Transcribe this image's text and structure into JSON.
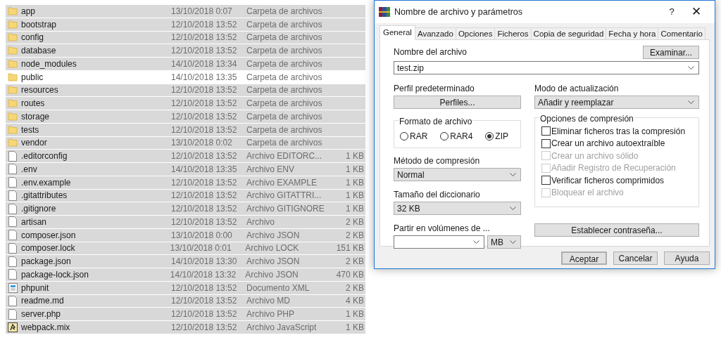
{
  "file_list": {
    "rows": [
      {
        "kind": "folder",
        "name": "app",
        "date": "13/10/2018 0:07",
        "type": "Carpeta de archivos",
        "selected": true
      },
      {
        "kind": "folder",
        "name": "bootstrap",
        "date": "12/10/2018 13:52",
        "type": "Carpeta de archivos",
        "selected": true
      },
      {
        "kind": "folder",
        "name": "config",
        "date": "12/10/2018 13:52",
        "type": "Carpeta de archivos",
        "selected": true
      },
      {
        "kind": "folder",
        "name": "database",
        "date": "12/10/2018 13:52",
        "type": "Carpeta de archivos",
        "selected": true
      },
      {
        "kind": "folder",
        "name": "node_modules",
        "date": "14/10/2018 13:34",
        "type": "Carpeta de archivos",
        "selected": true
      },
      {
        "kind": "folder",
        "name": "public",
        "date": "14/10/2018 13:35",
        "type": "Carpeta de archivos",
        "selected": false
      },
      {
        "kind": "folder",
        "name": "resources",
        "date": "12/10/2018 13:52",
        "type": "Carpeta de archivos",
        "selected": true
      },
      {
        "kind": "folder",
        "name": "routes",
        "date": "12/10/2018 13:52",
        "type": "Carpeta de archivos",
        "selected": true
      },
      {
        "kind": "folder",
        "name": "storage",
        "date": "12/10/2018 13:52",
        "type": "Carpeta de archivos",
        "selected": true
      },
      {
        "kind": "folder",
        "name": "tests",
        "date": "12/10/2018 13:52",
        "type": "Carpeta de archivos",
        "selected": true
      },
      {
        "kind": "folder",
        "name": "vendor",
        "date": "13/10/2018 0:02",
        "type": "Carpeta de archivos",
        "selected": true
      },
      {
        "kind": "file",
        "name": ".editorconfig",
        "date": "12/10/2018 13:52",
        "type": "Archivo EDITORC...",
        "size": "1 KB",
        "selected": true
      },
      {
        "kind": "file",
        "name": ".env",
        "date": "14/10/2018 13:35",
        "type": "Archivo ENV",
        "size": "1 KB",
        "selected": true
      },
      {
        "kind": "file",
        "name": ".env.example",
        "date": "12/10/2018 13:52",
        "type": "Archivo EXAMPLE",
        "size": "1 KB",
        "selected": true
      },
      {
        "kind": "file",
        "name": ".gitattributes",
        "date": "12/10/2018 13:52",
        "type": "Archivo GITATTRI...",
        "size": "1 KB",
        "selected": true
      },
      {
        "kind": "file",
        "name": ".gitignore",
        "date": "12/10/2018 13:52",
        "type": "Archivo GITIGNORE",
        "size": "1 KB",
        "selected": true
      },
      {
        "kind": "file",
        "name": "artisan",
        "date": "12/10/2018 13:52",
        "type": "Archivo",
        "size": "2 KB",
        "selected": true
      },
      {
        "kind": "file",
        "name": "composer.json",
        "date": "13/10/2018 0:00",
        "type": "Archivo JSON",
        "size": "2 KB",
        "selected": true
      },
      {
        "kind": "file",
        "name": "composer.lock",
        "date": "13/10/2018 0:01",
        "type": "Archivo LOCK",
        "size": "151 KB",
        "selected": true
      },
      {
        "kind": "file",
        "name": "package.json",
        "date": "14/10/2018 13:30",
        "type": "Archivo JSON",
        "size": "2 KB",
        "selected": true
      },
      {
        "kind": "file",
        "name": "package-lock.json",
        "date": "14/10/2018 13:32",
        "type": "Archivo JSON",
        "size": "470 KB",
        "selected": true
      },
      {
        "kind": "xml",
        "name": "phpunit",
        "date": "12/10/2018 13:52",
        "type": "Documento XML",
        "size": "2 KB",
        "selected": true
      },
      {
        "kind": "file",
        "name": "readme.md",
        "date": "12/10/2018 13:52",
        "type": "Archivo MD",
        "size": "4 KB",
        "selected": true
      },
      {
        "kind": "file",
        "name": "server.php",
        "date": "12/10/2018 13:52",
        "type": "Archivo PHP",
        "size": "1 KB",
        "selected": true
      },
      {
        "kind": "script",
        "name": "webpack.mix",
        "date": "12/10/2018 13:52",
        "type": "Archivo JavaScript",
        "size": "1 KB",
        "selected": true
      }
    ]
  },
  "dialog": {
    "title": "Nombre de archivo y parámetros",
    "help": "?",
    "close": "✕",
    "tabs": [
      {
        "label": "General",
        "selected": true
      },
      {
        "label": "Avanzado",
        "selected": false
      },
      {
        "label": "Opciones",
        "selected": false
      },
      {
        "label": "Ficheros",
        "selected": false
      },
      {
        "label": "Copia de seguridad",
        "selected": false
      },
      {
        "label": "Fecha y hora",
        "selected": false
      },
      {
        "label": "Comentario",
        "selected": false
      }
    ],
    "file_name_label": "Nombre del archivo",
    "browse_button": "Examinar...",
    "file_name": "test.zip",
    "profile_label": "Perfil predeterminado",
    "profiles_button": "Perfiles...",
    "update_mode_label": "Modo de actualización",
    "update_mode": "Añadir y reemplazar",
    "format_label": "Formato de archivo",
    "formats": [
      {
        "label": "RAR",
        "selected": false
      },
      {
        "label": "RAR4",
        "selected": false
      },
      {
        "label": "ZIP",
        "selected": true
      }
    ],
    "method_label": "Método de compresión",
    "method": "Normal",
    "dictionary_label": "Tamaño del diccionario",
    "dictionary": "32 KB",
    "split_label": "Partir en volúmenes de ...",
    "split_unit": "MB",
    "options_label": "Opciones de compresión",
    "options": [
      {
        "label": "Eliminar ficheros tras la compresión",
        "checked": false,
        "disabled": false
      },
      {
        "label": "Crear un archivo autoextraíble",
        "checked": false,
        "disabled": false
      },
      {
        "label": "Crear un archivo sólido",
        "checked": false,
        "disabled": true
      },
      {
        "label": "Añadir Registro de Recuperación",
        "checked": false,
        "disabled": true
      },
      {
        "label": "Verificar ficheros comprimidos",
        "checked": false,
        "disabled": false
      },
      {
        "label": "Bloquear el archivo",
        "checked": false,
        "disabled": true
      }
    ],
    "password_button": "Establecer contraseña...",
    "buttons": [
      "Aceptar",
      "Cancelar",
      "Ayuda"
    ]
  }
}
